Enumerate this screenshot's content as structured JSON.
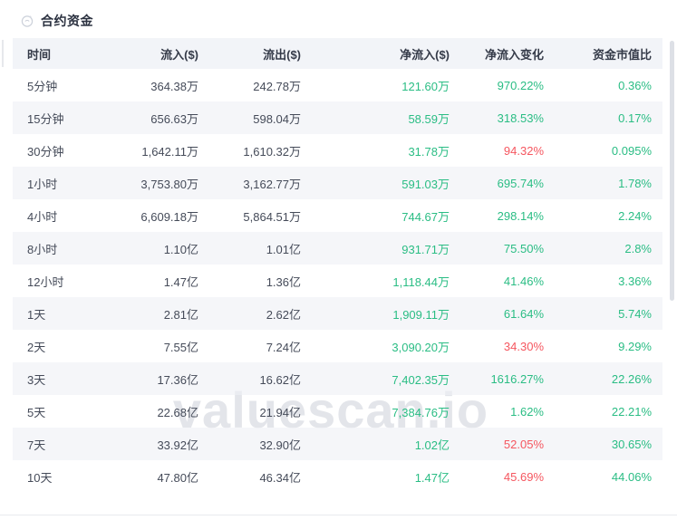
{
  "title": {
    "text": "合约资金"
  },
  "watermark": "valuescan.io",
  "colors": {
    "positive_green": "#2abd84",
    "negative_red": "#f5565f",
    "header_bg": "#f2f4f8",
    "row_alt_bg": "#eff1f6",
    "watermark_gray": "#e3e5ea"
  },
  "table": {
    "column_keys": [
      "time",
      "inflow",
      "outflow",
      "net-inflow",
      "net-inflow-change",
      "fund-marketcap-ratio"
    ],
    "columns": [
      "时间",
      "流入($)",
      "流出($)",
      "净流入($)",
      "净流入变化",
      "资金市值比"
    ],
    "rows": [
      {
        "cells": [
          {
            "text": "5分钟",
            "color": "dark"
          },
          {
            "text": "364.38万",
            "color": "dark"
          },
          {
            "text": "242.78万",
            "color": "dark"
          },
          {
            "text": "121.60万",
            "color": "green"
          },
          {
            "text": "970.22%",
            "color": "green"
          },
          {
            "text": "0.36%",
            "color": "green"
          }
        ]
      },
      {
        "cells": [
          {
            "text": "15分钟",
            "color": "dark"
          },
          {
            "text": "656.63万",
            "color": "dark"
          },
          {
            "text": "598.04万",
            "color": "dark"
          },
          {
            "text": "58.59万",
            "color": "green"
          },
          {
            "text": "318.53%",
            "color": "green"
          },
          {
            "text": "0.17%",
            "color": "green"
          }
        ]
      },
      {
        "cells": [
          {
            "text": "30分钟",
            "color": "dark"
          },
          {
            "text": "1,642.11万",
            "color": "dark"
          },
          {
            "text": "1,610.32万",
            "color": "dark"
          },
          {
            "text": "31.78万",
            "color": "green"
          },
          {
            "text": "94.32%",
            "color": "red"
          },
          {
            "text": "0.095%",
            "color": "green"
          }
        ]
      },
      {
        "cells": [
          {
            "text": "1小时",
            "color": "dark"
          },
          {
            "text": "3,753.80万",
            "color": "dark"
          },
          {
            "text": "3,162.77万",
            "color": "dark"
          },
          {
            "text": "591.03万",
            "color": "green"
          },
          {
            "text": "695.74%",
            "color": "green"
          },
          {
            "text": "1.78%",
            "color": "green"
          }
        ]
      },
      {
        "cells": [
          {
            "text": "4小时",
            "color": "dark"
          },
          {
            "text": "6,609.18万",
            "color": "dark"
          },
          {
            "text": "5,864.51万",
            "color": "dark"
          },
          {
            "text": "744.67万",
            "color": "green"
          },
          {
            "text": "298.14%",
            "color": "green"
          },
          {
            "text": "2.24%",
            "color": "green"
          }
        ]
      },
      {
        "cells": [
          {
            "text": "8小时",
            "color": "dark"
          },
          {
            "text": "1.10亿",
            "color": "dark"
          },
          {
            "text": "1.01亿",
            "color": "dark"
          },
          {
            "text": "931.71万",
            "color": "green"
          },
          {
            "text": "75.50%",
            "color": "green"
          },
          {
            "text": "2.8%",
            "color": "green"
          }
        ]
      },
      {
        "cells": [
          {
            "text": "12小时",
            "color": "dark"
          },
          {
            "text": "1.47亿",
            "color": "dark"
          },
          {
            "text": "1.36亿",
            "color": "dark"
          },
          {
            "text": "1,118.44万",
            "color": "green"
          },
          {
            "text": "41.46%",
            "color": "green"
          },
          {
            "text": "3.36%",
            "color": "green"
          }
        ]
      },
      {
        "cells": [
          {
            "text": "1天",
            "color": "dark"
          },
          {
            "text": "2.81亿",
            "color": "dark"
          },
          {
            "text": "2.62亿",
            "color": "dark"
          },
          {
            "text": "1,909.11万",
            "color": "green"
          },
          {
            "text": "61.64%",
            "color": "green"
          },
          {
            "text": "5.74%",
            "color": "green"
          }
        ]
      },
      {
        "cells": [
          {
            "text": "2天",
            "color": "dark"
          },
          {
            "text": "7.55亿",
            "color": "dark"
          },
          {
            "text": "7.24亿",
            "color": "dark"
          },
          {
            "text": "3,090.20万",
            "color": "green"
          },
          {
            "text": "34.30%",
            "color": "red"
          },
          {
            "text": "9.29%",
            "color": "green"
          }
        ]
      },
      {
        "cells": [
          {
            "text": "3天",
            "color": "dark"
          },
          {
            "text": "17.36亿",
            "color": "dark"
          },
          {
            "text": "16.62亿",
            "color": "dark"
          },
          {
            "text": "7,402.35万",
            "color": "green"
          },
          {
            "text": "1616.27%",
            "color": "green"
          },
          {
            "text": "22.26%",
            "color": "green"
          }
        ]
      },
      {
        "cells": [
          {
            "text": "5天",
            "color": "dark"
          },
          {
            "text": "22.68亿",
            "color": "dark"
          },
          {
            "text": "21.94亿",
            "color": "dark"
          },
          {
            "text": "7,384.76万",
            "color": "green"
          },
          {
            "text": "1.62%",
            "color": "green"
          },
          {
            "text": "22.21%",
            "color": "green"
          }
        ]
      },
      {
        "cells": [
          {
            "text": "7天",
            "color": "dark"
          },
          {
            "text": "33.92亿",
            "color": "dark"
          },
          {
            "text": "32.90亿",
            "color": "dark"
          },
          {
            "text": "1.02亿",
            "color": "green"
          },
          {
            "text": "52.05%",
            "color": "red"
          },
          {
            "text": "30.65%",
            "color": "green"
          }
        ]
      },
      {
        "cells": [
          {
            "text": "10天",
            "color": "dark"
          },
          {
            "text": "47.80亿",
            "color": "dark"
          },
          {
            "text": "46.34亿",
            "color": "dark"
          },
          {
            "text": "1.47亿",
            "color": "green"
          },
          {
            "text": "45.69%",
            "color": "red"
          },
          {
            "text": "44.06%",
            "color": "green"
          }
        ]
      }
    ]
  }
}
